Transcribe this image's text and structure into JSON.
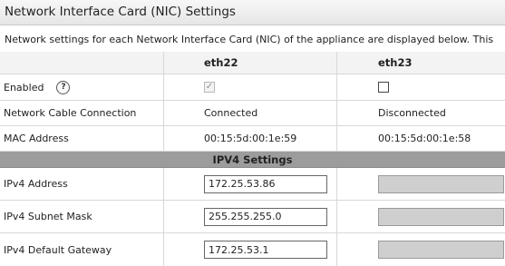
{
  "title": "Network Interface Card (NIC) Settings",
  "description": "Network settings for each Network Interface Card (NIC) of the appliance are displayed below. This",
  "columns": [
    "eth22",
    "eth23"
  ],
  "enabled": {
    "label": "Enabled",
    "help_icon": "help-icon",
    "help_glyph": "?",
    "eth22_checked": true,
    "eth23_checked": false,
    "check_glyph": "✓"
  },
  "cable": {
    "label": "Network Cable Connection",
    "eth22": "Connected",
    "eth23": "Disconnected"
  },
  "mac": {
    "label": "MAC Address",
    "eth22": "00:15:5d:00:1e:59",
    "eth23": "00:15:5d:00:1e:58"
  },
  "ipv4_section": "IPV4 Settings",
  "ipv4_address": {
    "label": "IPv4 Address",
    "eth22": "172.25.53.86",
    "eth23": ""
  },
  "ipv4_mask": {
    "label": "IPv4 Subnet Mask",
    "eth22": "255.255.255.0",
    "eth23": ""
  },
  "ipv4_gateway": {
    "label": "IPv4 Default Gateway",
    "eth22": "172.25.53.1",
    "eth23": ""
  },
  "colors": {
    "section_bg": "#9c9c9c",
    "disabled_input": "#cfcfcf"
  }
}
